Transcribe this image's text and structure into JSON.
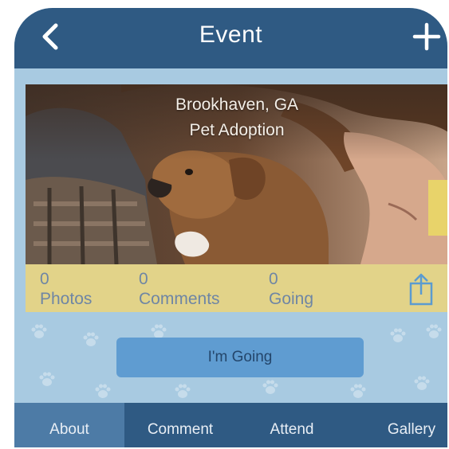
{
  "navbar": {
    "title": "Event",
    "back_icon": "chevron-left-icon",
    "add_icon": "plus-icon"
  },
  "event": {
    "location": "Brookhaven, GA",
    "name": "Pet Adoption",
    "photo_alt": "person hugging a puppy"
  },
  "stats": [
    {
      "count": "0",
      "label": "Photos"
    },
    {
      "count": "0",
      "label": "Comments"
    },
    {
      "count": "0",
      "label": "Going"
    }
  ],
  "share_icon": "share-icon",
  "going_button": "I'm Going",
  "tabs": [
    {
      "label": "About",
      "active": true
    },
    {
      "label": "Comment",
      "active": false
    },
    {
      "label": "Attend",
      "active": false
    },
    {
      "label": "Gallery",
      "active": false
    }
  ],
  "colors": {
    "navbar": "#2f5a83",
    "background": "#a8cae1",
    "stats_bar": "#e2d389",
    "stats_text": "#6f86a4",
    "button": "#5f9cd1",
    "tab_active": "#4d7ba6"
  }
}
